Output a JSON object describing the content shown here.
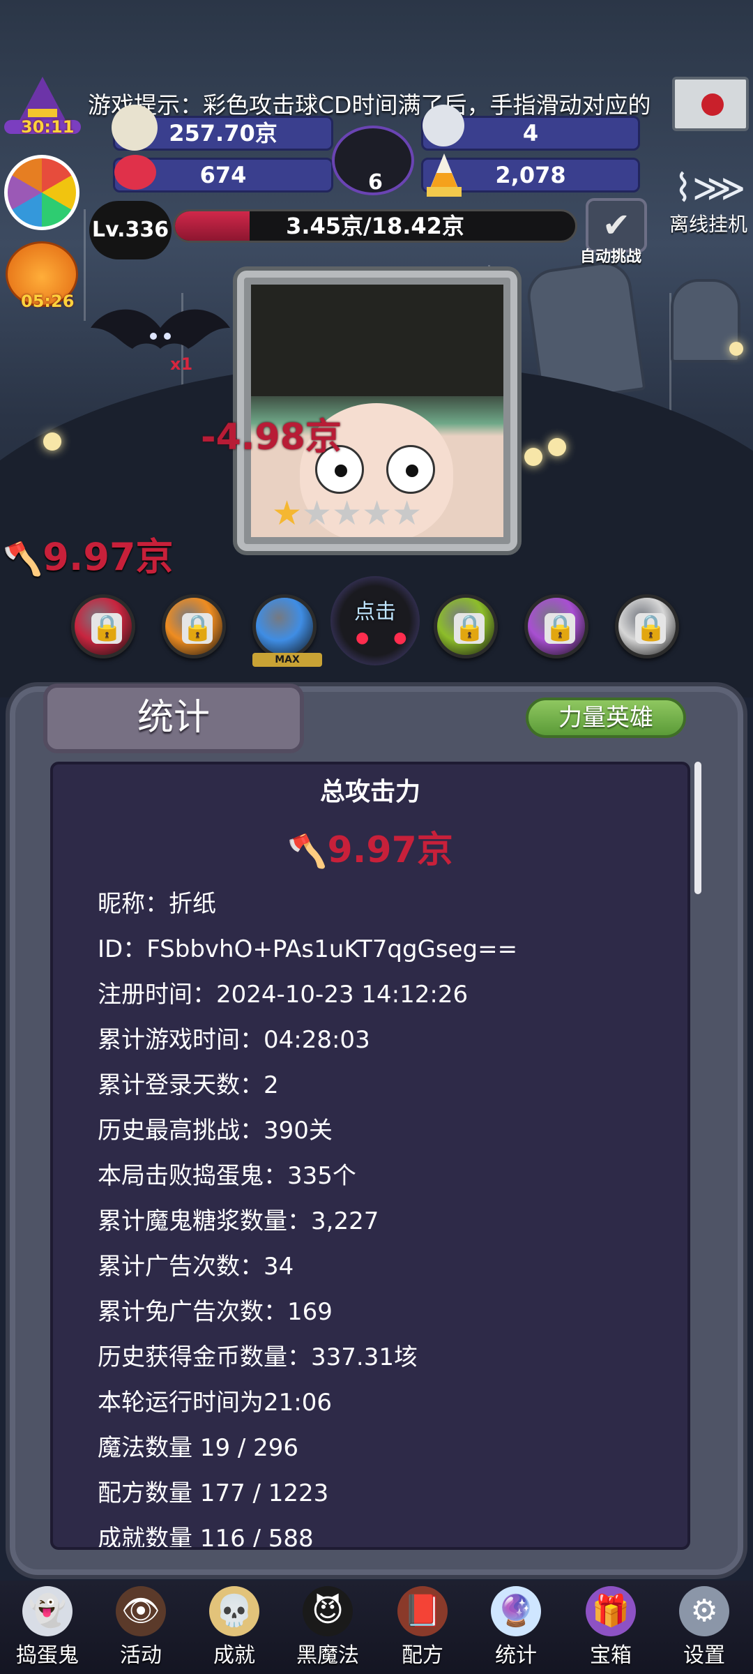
{
  "hint": "游戏提示：彩色攻击球CD时间满了后，手指滑动对应的",
  "timers": {
    "hat": "30:11",
    "pumpkin": "05:26"
  },
  "resources": {
    "coins": "257.70京",
    "skull_count": "4",
    "candy_count": "674",
    "cauldron_count": "6",
    "corn_count": "2,078"
  },
  "level": {
    "label": "Lv.336",
    "progress_text": "3.45京/18.42京",
    "progress_fraction": 0.187
  },
  "auto_challenge": {
    "label": "自动挑战",
    "icon": "check-icon"
  },
  "offline": {
    "label": "离线挂机",
    "icon": "fish-bone-icon"
  },
  "battle": {
    "damage_float": "-4.98京",
    "attack_left": "9.97京",
    "bat_multiplier": "x1",
    "stars_on": 1,
    "stars_total": 5,
    "click_label": "点击",
    "max_label": "MAX"
  },
  "skill_orbs": [
    {
      "color": "#c8253f",
      "locked": true
    },
    {
      "color": "#ee8c21",
      "locked": true
    },
    {
      "color": "#3f8de4",
      "locked": false
    },
    {
      "color": "#8dbd2a",
      "locked": true
    },
    {
      "color": "#a84fd1",
      "locked": true
    },
    {
      "color": "#d6d6d6",
      "locked": true
    }
  ],
  "panel": {
    "tab_title": "统计",
    "tab_button": "力量英雄",
    "header": "总攻击力",
    "total_attack": "9.97京",
    "stats": [
      "昵称：折纸",
      "ID：FSbbvhO+PAs1uKT7qgGseg==",
      "注册时间：2024-10-23 14:12:26",
      "累计游戏时间：04:28:03",
      "累计登录天数：2",
      "历史最高挑战：390关",
      "本局击败捣蛋鬼：335个",
      "累计魔鬼糖浆数量：3,227",
      "累计广告次数：34",
      "累计免广告次数：169",
      "历史获得金币数量：337.31垓",
      "本轮运行时间为21:06",
      "魔法数量 19 / 296",
      "配方数量 177 / 1223",
      "成就数量 116 / 588"
    ]
  },
  "nav": [
    {
      "label": "捣蛋鬼",
      "icon": "ghost-icon"
    },
    {
      "label": "活动",
      "icon": "eyeballs-icon"
    },
    {
      "label": "成就",
      "icon": "skull-trophy-icon"
    },
    {
      "label": "黑魔法",
      "icon": "devil-icon"
    },
    {
      "label": "配方",
      "icon": "spellbook-icon"
    },
    {
      "label": "统计",
      "icon": "crystal-ball-icon"
    },
    {
      "label": "宝箱",
      "icon": "chest-icon"
    },
    {
      "label": "设置",
      "icon": "gear-icon"
    }
  ]
}
